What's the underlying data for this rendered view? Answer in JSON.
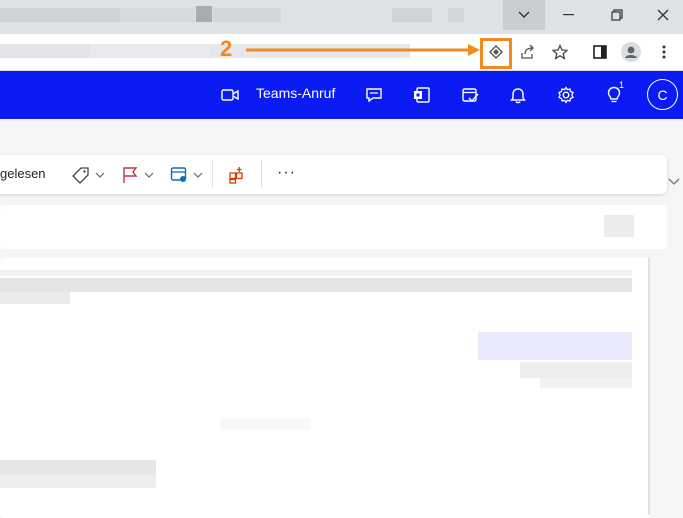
{
  "browser": {
    "icons": {
      "tab_search": "chevron-down-icon",
      "minimize": "minimize-icon",
      "restore": "restore-icon",
      "close": "close-icon",
      "extension": "extension-diamond-icon",
      "share": "share-icon",
      "bookmark": "star-icon",
      "side_panel": "side-panel-icon",
      "profile": "profile-icon",
      "menu": "kebab-menu-icon"
    }
  },
  "annotation": {
    "step_number": "2",
    "color": "#f28a20"
  },
  "outlook_header": {
    "background": "#0a1bf4",
    "teams_call_label": "Teams-Anruf",
    "tips_badge": "1",
    "avatar_initial": "C"
  },
  "ribbon": {
    "read_label": "gelesen",
    "more_label": "···"
  }
}
